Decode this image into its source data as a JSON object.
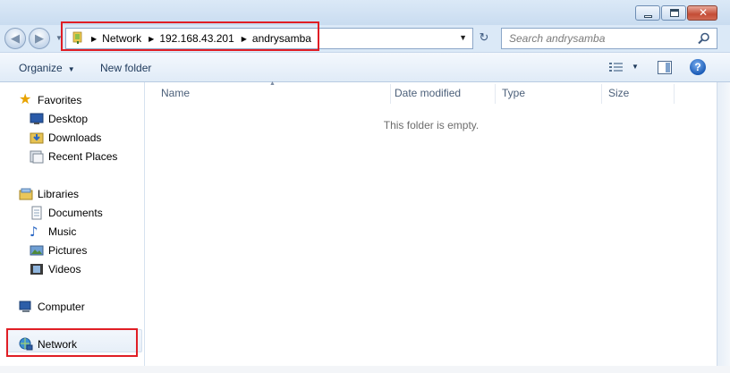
{
  "window": {
    "buttons": {
      "minimize": "minimize",
      "maximize": "maximize",
      "close": "✕"
    }
  },
  "address": {
    "crumbs": [
      "Network",
      "192.168.43.201",
      "andrysamba"
    ]
  },
  "search": {
    "placeholder": "Search andrysamba"
  },
  "toolbar": {
    "organize_label": "Organize",
    "new_folder_label": "New folder"
  },
  "sidebar": {
    "favorites": {
      "label": "Favorites",
      "items": [
        {
          "label": "Desktop",
          "icon": "desktop-icon"
        },
        {
          "label": "Downloads",
          "icon": "downloads-icon"
        },
        {
          "label": "Recent Places",
          "icon": "recent-places-icon"
        }
      ]
    },
    "libraries": {
      "label": "Libraries",
      "items": [
        {
          "label": "Documents",
          "icon": "documents-icon"
        },
        {
          "label": "Music",
          "icon": "music-icon"
        },
        {
          "label": "Pictures",
          "icon": "pictures-icon"
        },
        {
          "label": "Videos",
          "icon": "videos-icon"
        }
      ]
    },
    "computer": {
      "label": "Computer"
    },
    "network": {
      "label": "Network"
    }
  },
  "columns": [
    "Name",
    "Date modified",
    "Type",
    "Size"
  ],
  "content": {
    "empty_message": "This folder is empty."
  },
  "colors": {
    "highlight": "#e01e25",
    "titlebar": "#dbe9f7",
    "link_text": "#1e395b"
  }
}
